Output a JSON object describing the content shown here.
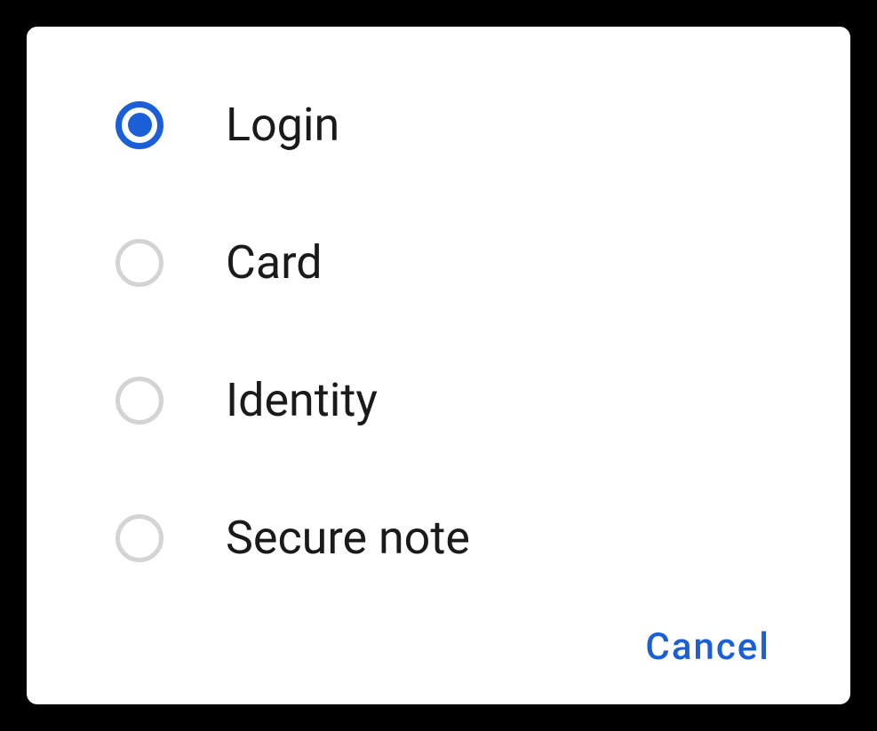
{
  "options": [
    {
      "label": "Login",
      "selected": true
    },
    {
      "label": "Card",
      "selected": false
    },
    {
      "label": "Identity",
      "selected": false
    },
    {
      "label": "Secure note",
      "selected": false
    }
  ],
  "actions": {
    "cancel": "Cancel"
  }
}
